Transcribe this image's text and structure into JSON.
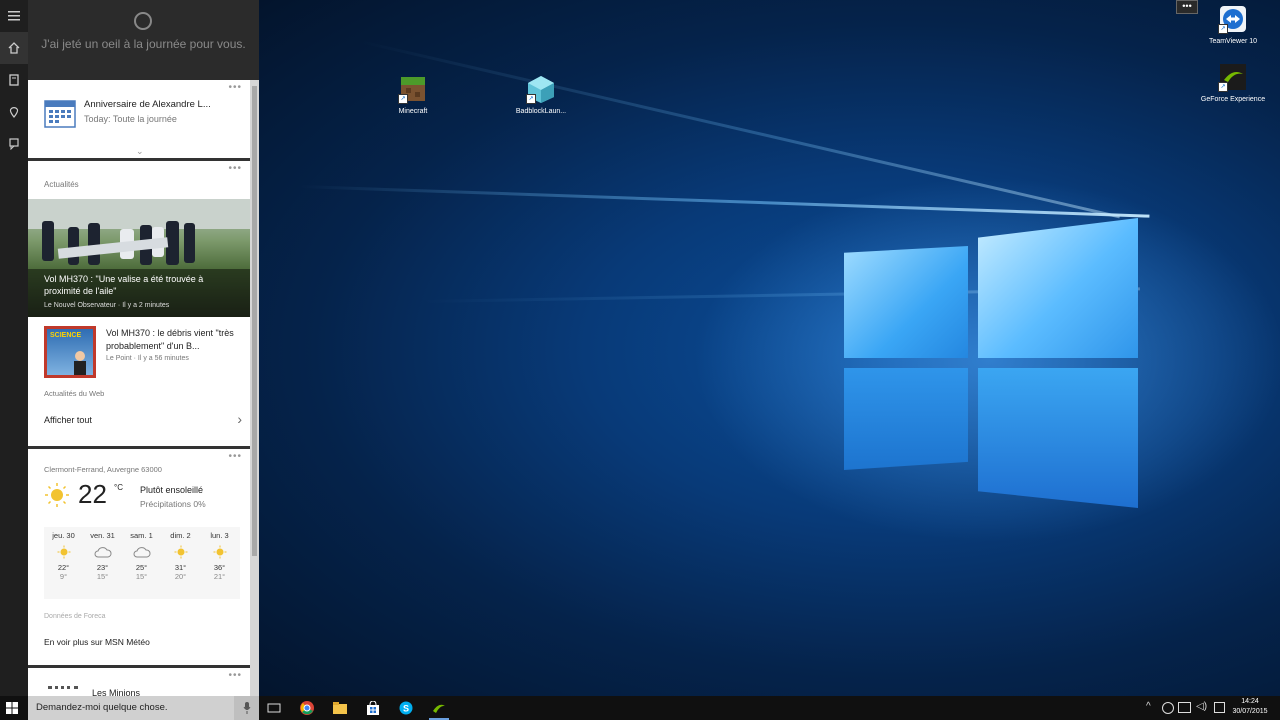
{
  "cortana": {
    "greeting": "J'ai jeté un oeil à la journée pour vous.",
    "calendar": {
      "title": "Anniversaire de Alexandre L...",
      "subtitle": "Today: Toute la journée"
    },
    "news": {
      "section_label": "Actualités",
      "top_story": {
        "headline": "Vol MH370 : \"Une valise a été trouvée à proximité de l'aile\"",
        "source": "Le Nouvel Observateur · Il y a 2 minutes"
      },
      "second_story": {
        "headline": "Vol MH370 : le débris vient \"très probablement\" d'un B...",
        "source": "Le Point · Il y a 56 minutes",
        "thumb_text": "SCIENCE"
      },
      "web_label": "Actualités du Web",
      "show_all": "Afficher tout"
    },
    "weather": {
      "location": "Clermont-Ferrand, Auvergne 63000",
      "temp": "22",
      "unit": "°C",
      "condition": "Plutôt ensoleillé",
      "precip": "Précipitations 0%",
      "forecast": [
        {
          "day": "jeu. 30",
          "icon": "sun-icon",
          "high": "22°",
          "low": "9°"
        },
        {
          "day": "ven. 31",
          "icon": "cloud-icon",
          "high": "23°",
          "low": "15°"
        },
        {
          "day": "sam. 1",
          "icon": "cloud-icon",
          "high": "25°",
          "low": "15°"
        },
        {
          "day": "dim. 2",
          "icon": "sun-icon",
          "high": "31°",
          "low": "20°"
        },
        {
          "day": "lun. 3",
          "icon": "sun-icon",
          "high": "36°",
          "low": "21°"
        }
      ],
      "provider": "Données de Foreca",
      "more_link": "En voir plus sur MSN Météo"
    },
    "next_card_title": "Les Minions"
  },
  "taskbar": {
    "search_placeholder": "Demandez-moi quelque chose.",
    "time": "14:24",
    "date": "30/07/2015"
  },
  "desktop": {
    "icons": [
      {
        "label": "Minecraft"
      },
      {
        "label": "BadblockLaun..."
      },
      {
        "label": "TeamViewer 10"
      },
      {
        "label": "GeForce Experience"
      }
    ]
  },
  "colors": {
    "panel_bg": "#2b2b2b",
    "card_bg": "#ffffff",
    "taskbar_bg": "#101010",
    "accent": "#1e6fd0",
    "weather_sun": "#f2c330"
  }
}
